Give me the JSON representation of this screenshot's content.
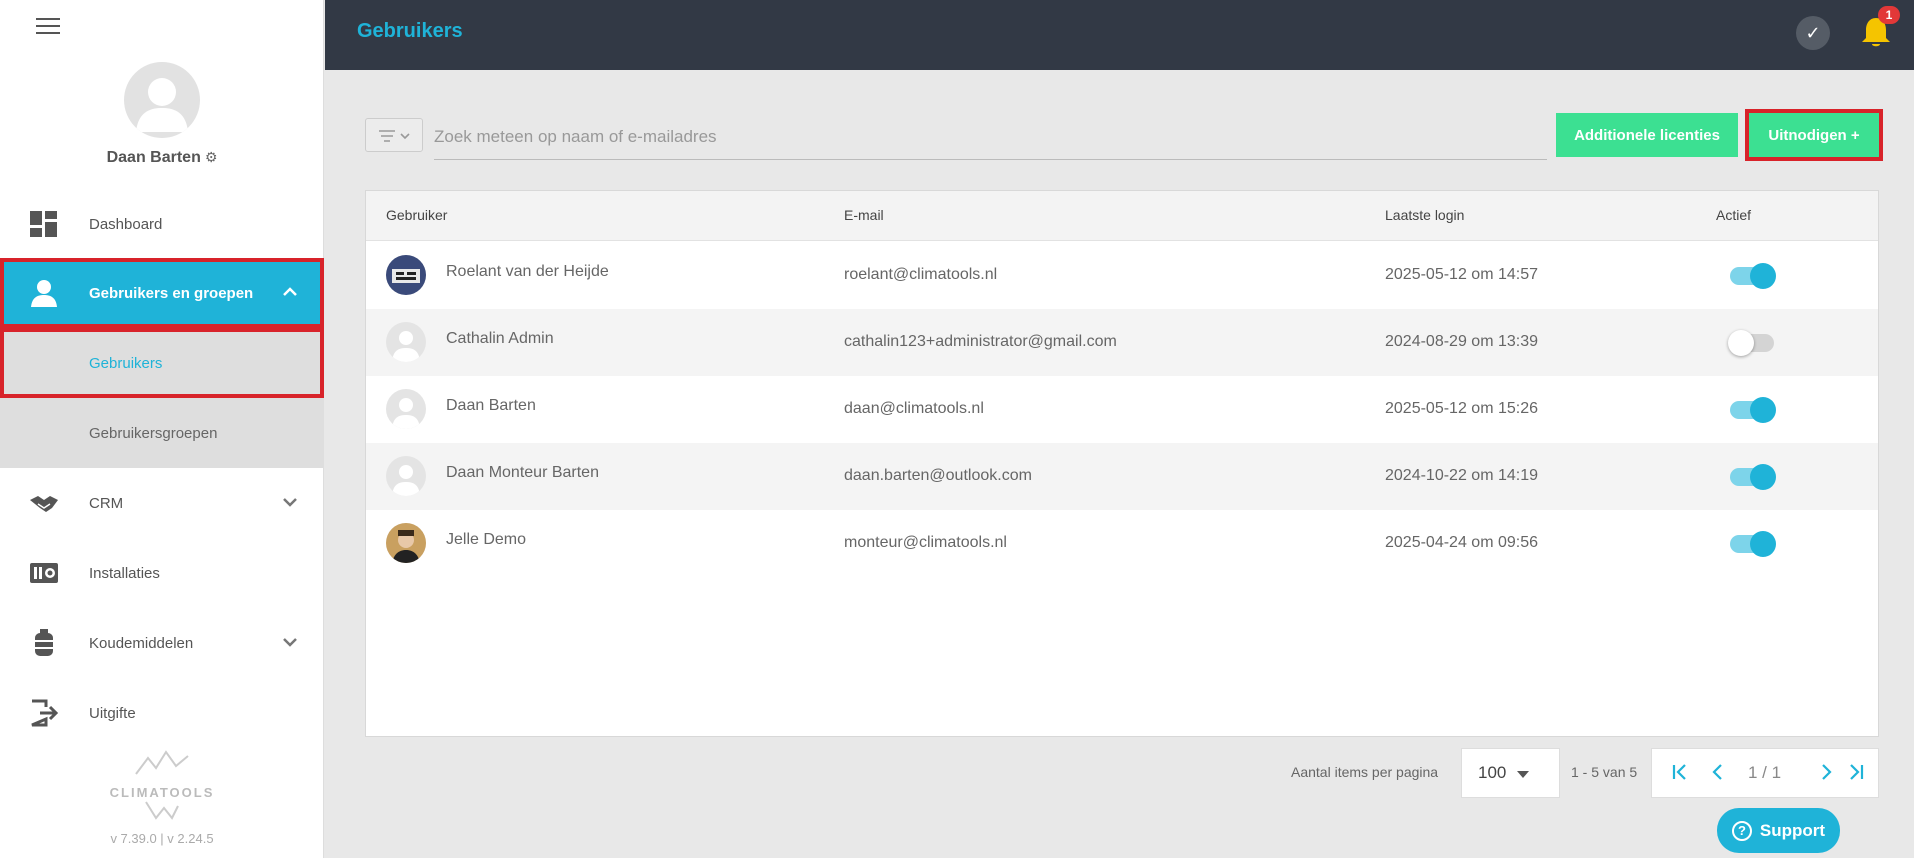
{
  "profile": {
    "name": "Daan Barten"
  },
  "nav": {
    "dashboard": "Dashboard",
    "users_groups": "Gebruikers en groepen",
    "users": "Gebruikers",
    "user_groups": "Gebruikersgroepen",
    "crm": "CRM",
    "installations": "Installaties",
    "refrigerants": "Koudemiddelen",
    "output": "Uitgifte"
  },
  "brand": {
    "name": "CLIMATOOLS",
    "version": "v 7.39.0 | v 2.24.5"
  },
  "header": {
    "title": "Gebruikers",
    "notification_count": "1"
  },
  "toolbar": {
    "search_placeholder": "Zoek meteen op naam of e-mailadres",
    "additional_licenses": "Additionele licenties",
    "invite": "Uitnodigen +"
  },
  "table": {
    "headers": {
      "user": "Gebruiker",
      "email": "E-mail",
      "last_login": "Laatste login",
      "active": "Actief"
    },
    "rows": [
      {
        "name": "Roelant van der Heijde",
        "email": "roelant@climatools.nl",
        "last_login": "2025-05-12 om 14:57",
        "active": true
      },
      {
        "name": "Cathalin Admin",
        "email": "cathalin123+administrator@gmail.com",
        "last_login": "2024-08-29 om 13:39",
        "active": false
      },
      {
        "name": "Daan Barten",
        "email": "daan@climatools.nl",
        "last_login": "2025-05-12 om 15:26",
        "active": true
      },
      {
        "name": "Daan Monteur Barten",
        "email": "daan.barten@outlook.com",
        "last_login": "2024-10-22 om 14:19",
        "active": true
      },
      {
        "name": "Jelle Demo",
        "email": "monteur@climatools.nl",
        "last_login": "2025-04-24 om 09:56",
        "active": true
      }
    ]
  },
  "pagination": {
    "items_per_page_label": "Aantal items per pagina",
    "items_per_page": "100",
    "range": "1 - 5 van 5",
    "page": "1 / 1"
  },
  "support": {
    "label": "Support"
  },
  "colors": {
    "accent": "#1fb3d8",
    "green": "#3ce092",
    "header_bg": "#323945",
    "highlight": "#d8232a"
  }
}
